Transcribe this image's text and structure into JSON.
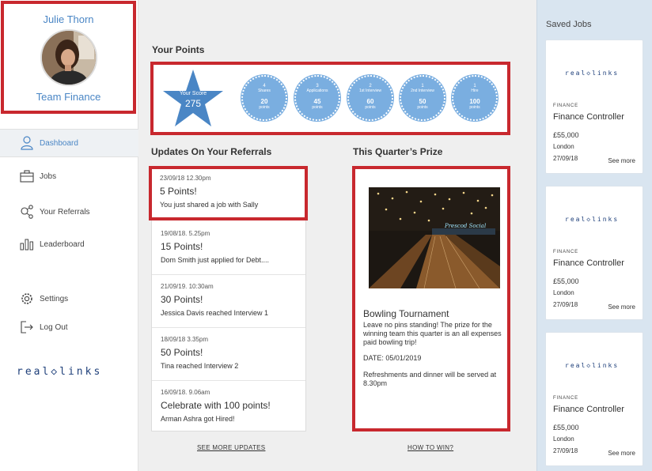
{
  "profile": {
    "name": "Julie Thorn",
    "team": "Team Finance"
  },
  "nav": [
    {
      "label": "Dashboard",
      "icon": "user-icon"
    },
    {
      "label": "Jobs",
      "icon": "briefcase-icon"
    },
    {
      "label": "Your Referrals",
      "icon": "referral-icon"
    },
    {
      "label": "Leaderboard",
      "icon": "bar-chart-icon"
    },
    {
      "label": "Settings",
      "icon": "gear-icon"
    },
    {
      "label": "Log Out",
      "icon": "logout-icon"
    }
  ],
  "brand": {
    "logo_text": "real◇links"
  },
  "points": {
    "title": "Your Points",
    "score_label": "Your Score",
    "score_value": "275",
    "badges": [
      {
        "count": "4",
        "label": "Shares",
        "value": "20",
        "unit": "points"
      },
      {
        "count": "3",
        "label": "Applications",
        "value": "45",
        "unit": "points"
      },
      {
        "count": "2",
        "label": "1st Interview",
        "value": "60",
        "unit": "points"
      },
      {
        "count": "1",
        "label": "2nd Interview",
        "value": "50",
        "unit": "points"
      },
      {
        "count": "1",
        "label": "Hire",
        "value": "100",
        "unit": "points"
      }
    ]
  },
  "updates": {
    "title": "Updates On Your Referrals",
    "items": [
      {
        "date": "23/09/18  12.30pm",
        "title": "5 Points!",
        "text": "You just shared a job with Sally"
      },
      {
        "date": "19/08/18. 5.25pm",
        "title": "15 Points!",
        "text": "Dom Smith just applied for Debt...."
      },
      {
        "date": "21/09/19. 10:30am",
        "title": "30 Points!",
        "text": "Jessica Davis reached Interview 1"
      },
      {
        "date": "18/09/18  3.35pm",
        "title": "50 Points!",
        "text": "Tina reached Interview 2"
      },
      {
        "date": "16/09/18. 9.06am",
        "title": "Celebrate with 100 points!",
        "text": "Arman Ashra got Hired!"
      }
    ],
    "more_link": "SEE MORE UPDATES"
  },
  "prize": {
    "section_title": "This Quarter’s Prize",
    "title": "Bowling Tournament",
    "description": "Leave no pins standing! The prize for the winning team this quarter is an all expenses paid bowling trip!",
    "date": "DATE:  05/01/2019",
    "extra": "Refreshments and dinner will be served at 8.30pm",
    "sign_text": "Prescod Social",
    "how_link": "HOW TO WIN?"
  },
  "saved": {
    "title": "Saved Jobs",
    "jobs": [
      {
        "category": "FINANCE",
        "title": "Finance Controller",
        "salary": "£55,000",
        "location": "London",
        "date": "27/09/18",
        "more": "See more"
      },
      {
        "category": "FINANCE",
        "title": "Finance Controller",
        "salary": "£55,000",
        "location": "London",
        "date": "27/09/18",
        "more": "See more"
      },
      {
        "category": "FINANCE",
        "title": "Finance Controller",
        "salary": "£55,000",
        "location": "London",
        "date": "27/09/18",
        "more": "See more"
      }
    ]
  },
  "colors": {
    "accent": "#4a86c5",
    "highlight": "#c8282e",
    "badge": "#7aaee0",
    "star": "#4a86c5",
    "logo": "#1e3f7a"
  }
}
